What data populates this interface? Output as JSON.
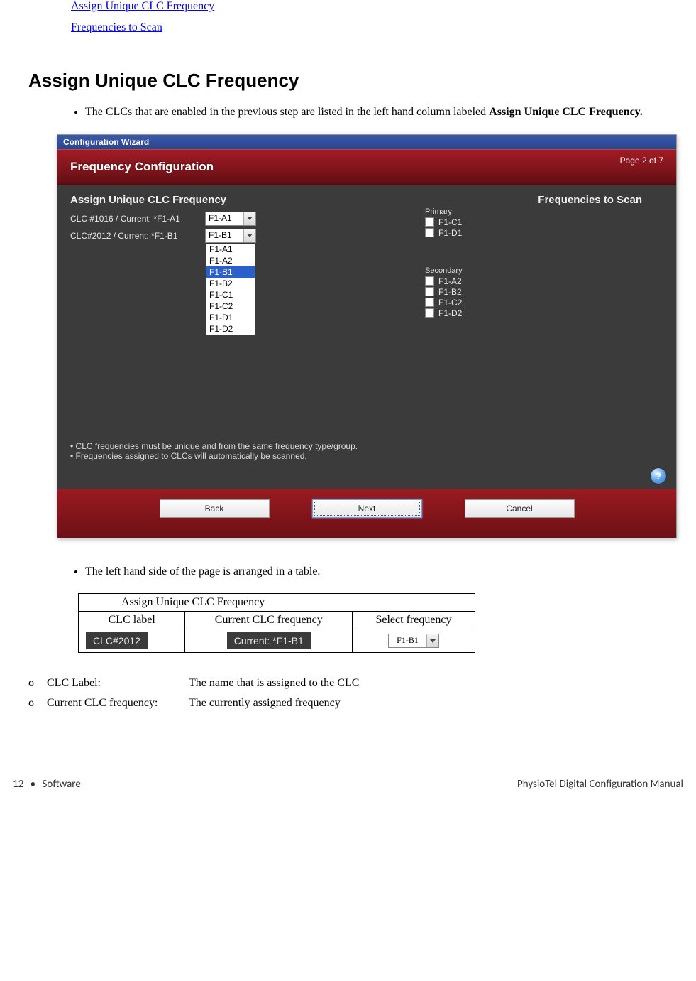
{
  "toc": {
    "link1": "Assign Unique CLC Frequency",
    "link2": "Frequencies to Scan"
  },
  "heading": "Assign Unique CLC Frequency",
  "bullet1_pre": "The CLCs that are enabled in the previous step are listed in the left hand column labeled ",
  "bullet1_strong": "Assign Unique CLC Frequency.",
  "wizard": {
    "titlebar": "Configuration Wizard",
    "header_title": "Frequency Configuration",
    "page_indicator": "Page 2 of 7",
    "left_heading": "Assign Unique CLC Frequency",
    "right_heading": "Frequencies to Scan",
    "clc_rows": [
      {
        "label": "CLC #1016  / Current: *F1-A1",
        "value": "F1-A1"
      },
      {
        "label": "CLC#2012  / Current: *F1-B1",
        "value": "F1-B1"
      }
    ],
    "dropdown_options": [
      "F1-A1",
      "F1-A2",
      "F1-B1",
      "F1-B2",
      "F1-C1",
      "F1-C2",
      "F1-D1",
      "F1-D2"
    ],
    "dropdown_selected": "F1-B1",
    "scan_primary_label": "Primary",
    "scan_primary": [
      "F1-C1",
      "F1-D1"
    ],
    "scan_secondary_label": "Secondary",
    "scan_secondary": [
      "F1-A2",
      "F1-B2",
      "F1-C2",
      "F1-D2"
    ],
    "note1": "CLC frequencies must be unique and from the same frequency type/group.",
    "note2": "Frequencies assigned to CLCs will automatically be scanned.",
    "btn_back": "Back",
    "btn_next": "Next",
    "btn_cancel": "Cancel"
  },
  "bullet2": "The left hand side of the page is arranged in a table.",
  "table": {
    "merged_header": "Assign Unique CLC Frequency",
    "col1": "CLC label",
    "col2": "Current CLC frequency",
    "col3": "Select frequency",
    "example_label": "CLC#2012",
    "example_current": "Current: *F1-B1",
    "example_select": "F1-B1"
  },
  "defs": [
    {
      "label": "CLC Label:",
      "desc": "The name that is assigned to the CLC"
    },
    {
      "label": "Current CLC frequency:",
      "desc": "The currently assigned frequency"
    }
  ],
  "footer": {
    "page_num": "12",
    "section": "Software",
    "manual": "PhysioTel Digital Configuration Manual"
  }
}
